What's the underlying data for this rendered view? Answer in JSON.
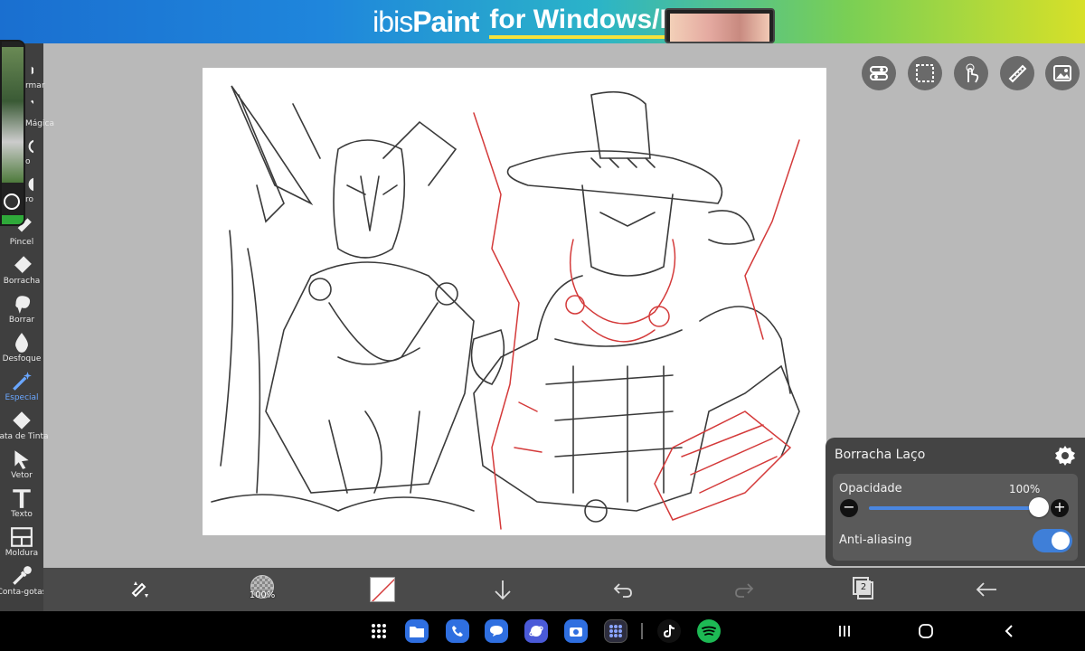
{
  "ad_banner": {
    "logo_thin": "ibis",
    "logo_bold": "Paint",
    "text": "for Windows/Mac"
  },
  "left_toolbar": {
    "tools": [
      {
        "label": "rmar",
        "icon": "transform-icon",
        "active": false
      },
      {
        "label": "Mágica",
        "icon": "magic-wand-icon",
        "active": false
      },
      {
        "label": "o",
        "icon": "lasso-icon",
        "active": false
      },
      {
        "label": "ro",
        "icon": "filter-icon",
        "active": false
      },
      {
        "label": "Pincel",
        "icon": "brush-icon",
        "active": false
      },
      {
        "label": "Borracha",
        "icon": "eraser-icon",
        "active": false
      },
      {
        "label": "Borrar",
        "icon": "smudge-icon",
        "active": false
      },
      {
        "label": "Desfoque",
        "icon": "blur-drop-icon",
        "active": false
      },
      {
        "label": "Especial",
        "icon": "special-wand-icon",
        "active": true
      },
      {
        "label": "Lata de Tinta",
        "icon": "paint-bucket-icon",
        "active": false
      },
      {
        "label": "Vetor",
        "icon": "vector-cursor-icon",
        "active": false
      },
      {
        "label": "Texto",
        "icon": "text-icon",
        "active": false
      },
      {
        "label": "Moldura",
        "icon": "frame-icon",
        "active": false
      },
      {
        "label": "Conta-gotas",
        "icon": "eyedropper-icon",
        "active": false
      }
    ]
  },
  "right_controls": [
    "toggle-panel-icon",
    "selection-icon",
    "touch-icon",
    "ruler-icon",
    "gallery-icon"
  ],
  "brush_panel": {
    "title": "Borracha Laço",
    "opacity_label": "Opacidade",
    "opacity_value": "100%",
    "opacity": 1.0,
    "minus": "−",
    "plus": "+",
    "antialias_label": "Anti-aliasing",
    "antialias_on": true
  },
  "bottom_toolbar": {
    "brush_size_label": "100%",
    "layer_count": "2"
  },
  "colors": {
    "accent_blue": "#3f7fd8",
    "toolbar_dark": "#3f3f3f",
    "sketch_red": "#d43a3a"
  }
}
